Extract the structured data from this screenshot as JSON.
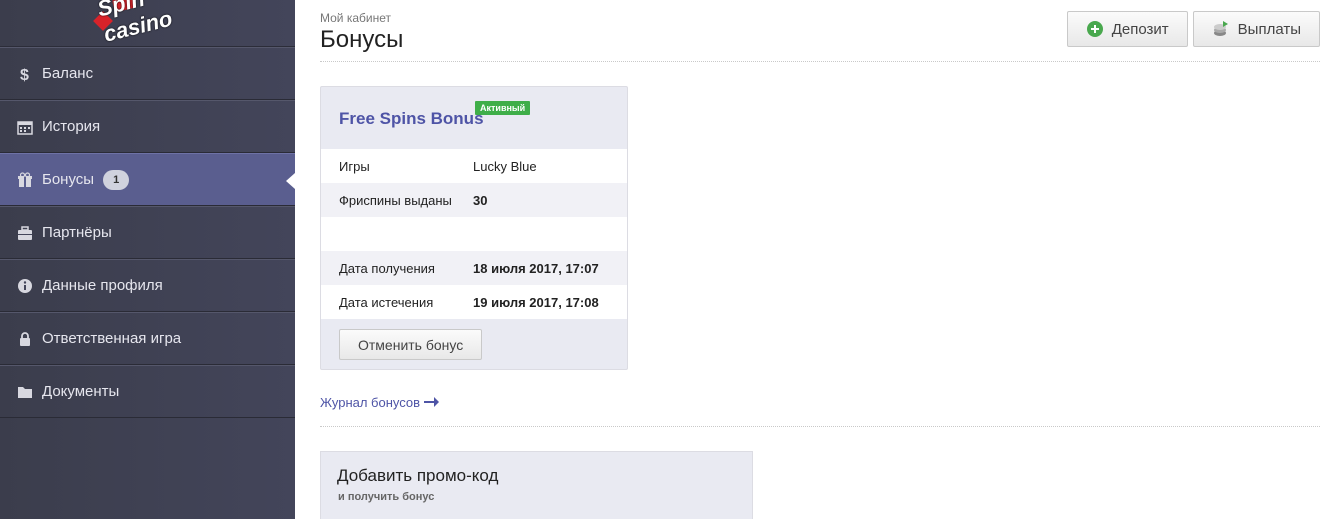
{
  "logo": {
    "text": "Spin casino"
  },
  "sidebar": {
    "items": [
      {
        "label": "Баланс",
        "icon": "dollar-icon"
      },
      {
        "label": "История",
        "icon": "calendar-icon"
      },
      {
        "label": "Бонусы",
        "icon": "gift-icon",
        "badge": "1",
        "active": true
      },
      {
        "label": "Партнёры",
        "icon": "briefcase-icon"
      },
      {
        "label": "Данные профиля",
        "icon": "info-icon"
      },
      {
        "label": "Ответственная игра",
        "icon": "lock-icon"
      },
      {
        "label": "Документы",
        "icon": "folder-icon"
      }
    ]
  },
  "header": {
    "breadcrumb": "Мой кабинет",
    "title": "Бонусы",
    "deposit_label": "Депозит",
    "payouts_label": "Выплаты"
  },
  "bonus": {
    "title": "Free Spins Bonus",
    "status": "Активный",
    "rows": [
      {
        "key": "Игры",
        "value": "Lucky Blue"
      },
      {
        "key": "Фриспины выданы",
        "value": "30"
      },
      {
        "key": "",
        "value": ""
      },
      {
        "key": "Дата получения",
        "value": "18 июля 2017, 17:07"
      },
      {
        "key": "Дата истечения",
        "value": "19 июля 2017, 17:08"
      }
    ],
    "cancel_label": "Отменить бонус"
  },
  "journal": {
    "label": "Журнал бонусов"
  },
  "promo": {
    "title": "Добавить промо-код",
    "subtitle": "и получить бонус"
  },
  "colors": {
    "sidebar_bg": "#3f4152",
    "active_item": "#5a5e8f",
    "accent": "#4e54a6",
    "status_green": "#3fae49"
  }
}
